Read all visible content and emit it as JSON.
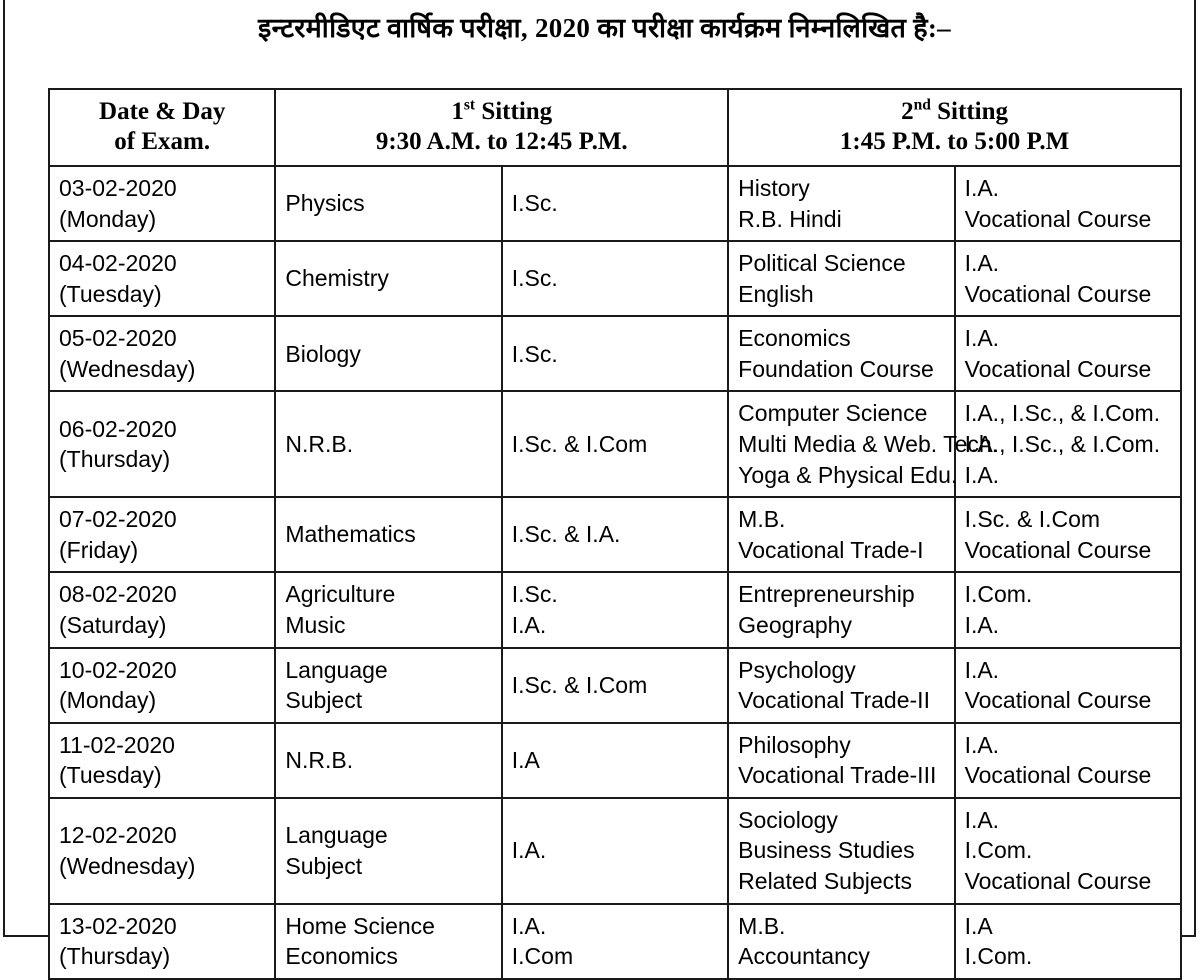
{
  "document": {
    "heading": "इन्टरमीडिएट वार्षिक परीक्षा, 2020 का परीक्षा कार्यक्रम निम्नलिखित है:–"
  },
  "table": {
    "headers": {
      "date_line1": "Date & Day",
      "date_line2": "of Exam.",
      "sitting1_label_pre": "1",
      "sitting1_label_sup": "st",
      "sitting1_label_post": " Sitting",
      "sitting1_time": "9:30 A.M. to 12:45 P.M.",
      "sitting2_label_pre": "2",
      "sitting2_label_sup": "nd",
      "sitting2_label_post": " Sitting",
      "sitting2_time": "1:45 P.M. to 5:00 P.M"
    },
    "rows": [
      {
        "date": "03-02-2020",
        "day": "(Monday)",
        "sitting1_subjects": [
          "Physics"
        ],
        "sitting1_groups": [
          "I.Sc."
        ],
        "sitting2_subjects": [
          "History",
          "R.B. Hindi"
        ],
        "sitting2_groups": [
          "I.A.",
          "Vocational Course"
        ]
      },
      {
        "date": "04-02-2020",
        "day": "(Tuesday)",
        "sitting1_subjects": [
          "Chemistry"
        ],
        "sitting1_groups": [
          "I.Sc."
        ],
        "sitting2_subjects": [
          "Political Science",
          "English"
        ],
        "sitting2_groups": [
          "I.A.",
          "Vocational Course"
        ]
      },
      {
        "date": "05-02-2020",
        "day": "(Wednesday)",
        "sitting1_subjects": [
          "Biology"
        ],
        "sitting1_groups": [
          "I.Sc."
        ],
        "sitting2_subjects": [
          "Economics",
          "Foundation Course"
        ],
        "sitting2_groups": [
          "I.A.",
          "Vocational Course"
        ]
      },
      {
        "date": "06-02-2020",
        "day": "(Thursday)",
        "sitting1_subjects": [
          "N.R.B."
        ],
        "sitting1_groups": [
          "I.Sc. & I.Com"
        ],
        "sitting2_subjects": [
          "Computer Science",
          "Multi Media & Web. Tech.",
          "Yoga & Physical Edu."
        ],
        "sitting2_groups": [
          "I.A., I.Sc., & I.Com.",
          "I.A., I.Sc., & I.Com.",
          "I.A."
        ]
      },
      {
        "date": "07-02-2020",
        "day": "(Friday)",
        "sitting1_subjects": [
          "Mathematics"
        ],
        "sitting1_groups": [
          "I.Sc. & I.A."
        ],
        "sitting2_subjects": [
          "M.B.",
          "Vocational Trade-I"
        ],
        "sitting2_groups": [
          "I.Sc. & I.Com",
          "Vocational Course"
        ]
      },
      {
        "date": "08-02-2020",
        "day": "(Saturday)",
        "sitting1_subjects": [
          "Agriculture",
          "Music"
        ],
        "sitting1_groups": [
          "I.Sc.",
          "I.A."
        ],
        "sitting2_subjects": [
          "Entrepreneurship",
          "Geography"
        ],
        "sitting2_groups": [
          "I.Com.",
          "I.A."
        ]
      },
      {
        "date": "10-02-2020",
        "day": "(Monday)",
        "sitting1_subjects": [
          "Language",
          "Subject"
        ],
        "sitting1_groups": [
          "I.Sc. & I.Com"
        ],
        "sitting2_subjects": [
          "Psychology",
          "Vocational Trade-II"
        ],
        "sitting2_groups": [
          "I.A.",
          "Vocational Course"
        ]
      },
      {
        "date": "11-02-2020",
        "day": "(Tuesday)",
        "sitting1_subjects": [
          "N.R.B."
        ],
        "sitting1_groups": [
          "I.A"
        ],
        "sitting2_subjects": [
          "Philosophy",
          "Vocational Trade-III"
        ],
        "sitting2_groups": [
          "I.A.",
          "Vocational Course"
        ]
      },
      {
        "date": "12-02-2020",
        "day": "(Wednesday)",
        "sitting1_subjects": [
          "Language",
          "Subject"
        ],
        "sitting1_groups": [
          "I.A."
        ],
        "sitting2_subjects": [
          "Sociology",
          "Business Studies",
          "Related Subjects"
        ],
        "sitting2_groups": [
          "I.A.",
          "I.Com.",
          "Vocational Course"
        ]
      },
      {
        "date": "13-02-2020",
        "day": "(Thursday)",
        "sitting1_subjects": [
          "Home Science",
          "Economics"
        ],
        "sitting1_groups": [
          "I.A.",
          "I.Com"
        ],
        "sitting2_subjects": [
          "M.B.",
          "Accountancy"
        ],
        "sitting2_groups": [
          "I.A",
          "I.Com."
        ]
      }
    ]
  }
}
